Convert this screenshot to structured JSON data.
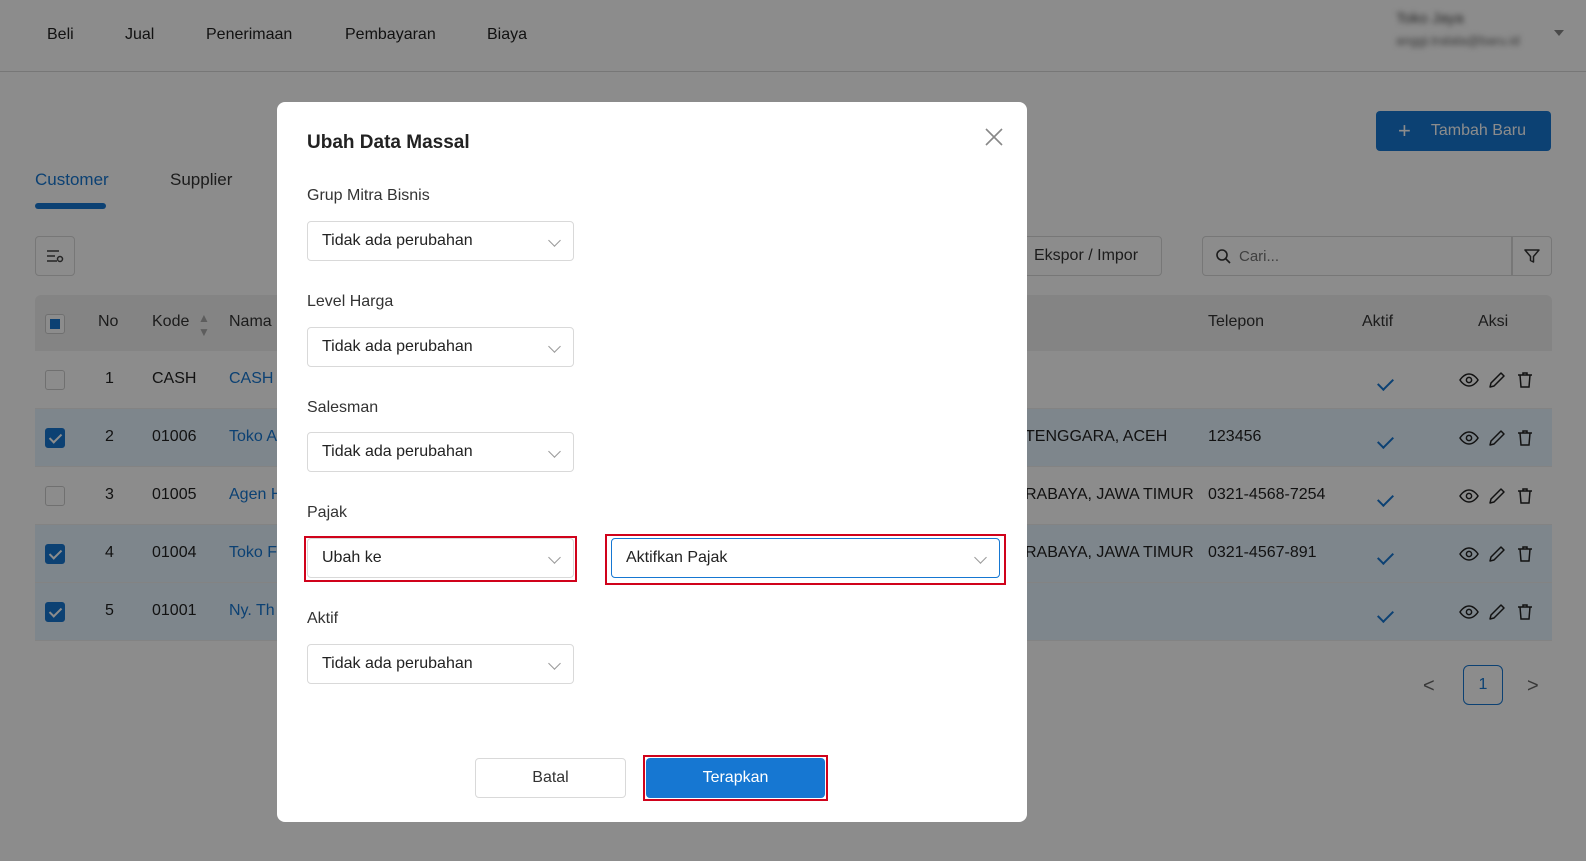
{
  "nav": {
    "items": [
      "Beli",
      "Jual",
      "Penerimaan",
      "Pembayaran",
      "Biaya"
    ],
    "user_name": "Toko Jaya",
    "user_email": "anggi.tralala@baru.id"
  },
  "page": {
    "add_button": "Tambah Baru",
    "tabs": [
      "Customer",
      "Supplier"
    ],
    "active_tab": "Customer",
    "export_button": "Ekspor / Impor",
    "search_placeholder": "Cari..."
  },
  "table": {
    "headers": {
      "no": "No",
      "kode": "Kode",
      "nama": "Nama",
      "telepon": "Telepon",
      "aktif": "Aktif",
      "aksi": "Aksi"
    },
    "rows": [
      {
        "checked": false,
        "no": "1",
        "kode": "CASH",
        "nama": "CASH",
        "alamat": "",
        "telepon": "",
        "aktif": true
      },
      {
        "checked": true,
        "no": "2",
        "kode": "01006",
        "nama": "Toko A",
        "alamat": "TENGGARA, ACEH",
        "telepon": "123456",
        "aktif": true
      },
      {
        "checked": false,
        "no": "3",
        "kode": "01005",
        "nama": "Agen H",
        "alamat": "RABAYA, JAWA TIMUR",
        "telepon": "0321-4568-7254",
        "aktif": true
      },
      {
        "checked": true,
        "no": "4",
        "kode": "01004",
        "nama": "Toko F",
        "alamat": "RABAYA, JAWA TIMUR",
        "telepon": "0321-4567-891",
        "aktif": true
      },
      {
        "checked": true,
        "no": "5",
        "kode": "01001",
        "nama": "Ny. Th",
        "alamat": "",
        "telepon": "",
        "aktif": true
      }
    ]
  },
  "pagination": {
    "current": "1",
    "prev": "<",
    "next": ">"
  },
  "modal": {
    "title": "Ubah Data Massal",
    "fields": {
      "grup_label": "Grup Mitra Bisnis",
      "grup_value": "Tidak ada perubahan",
      "level_label": "Level Harga",
      "level_value": "Tidak ada perubahan",
      "salesman_label": "Salesman",
      "salesman_value": "Tidak ada perubahan",
      "pajak_label": "Pajak",
      "pajak_mode": "Ubah ke",
      "pajak_value": "Aktifkan Pajak",
      "aktif_label": "Aktif",
      "aktif_value": "Tidak ada perubahan"
    },
    "cancel_button": "Batal",
    "apply_button": "Terapkan"
  },
  "colors": {
    "primary": "#1677d2",
    "highlight": "#d0021b",
    "overlay": "rgba(0,0,0,0.45)"
  }
}
